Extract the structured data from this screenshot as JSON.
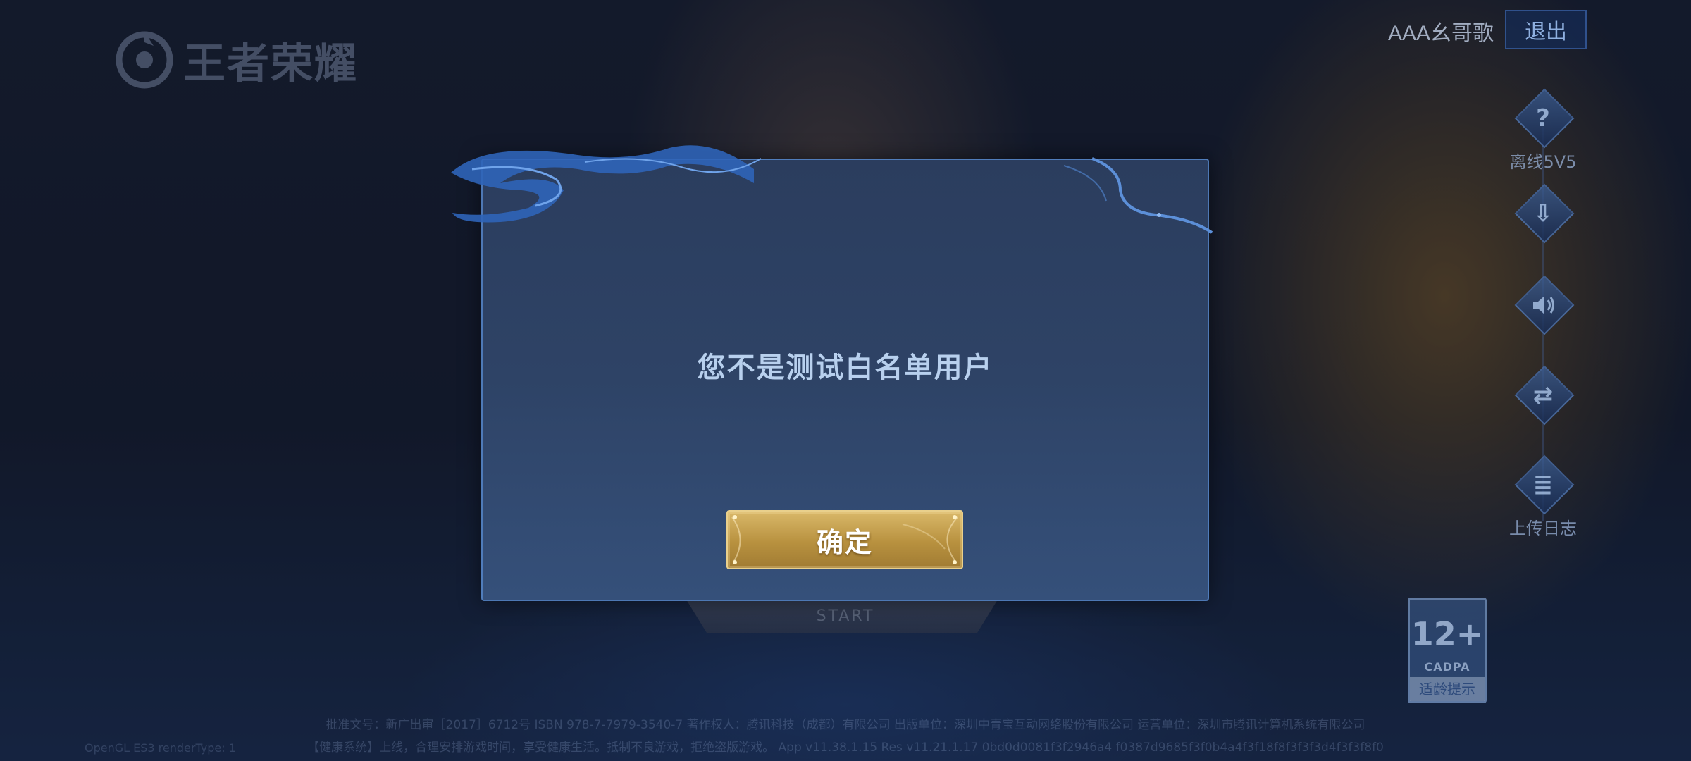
{
  "app": {
    "logo_text": "王者荣耀"
  },
  "header": {
    "user_name": "AAA幺哥歌",
    "exit_label": "退出"
  },
  "side_menu": {
    "items": [
      {
        "icon": "help-icon",
        "glyph": "?",
        "label": "离线5V5"
      },
      {
        "icon": "download-icon",
        "glyph": "⇩",
        "label": ""
      },
      {
        "icon": "speaker-icon",
        "glyph": "🔊",
        "label": ""
      },
      {
        "icon": "switch-account-icon",
        "glyph": "⇄",
        "label": ""
      },
      {
        "icon": "clipboard-icon",
        "glyph": "≣",
        "label": "上传日志"
      }
    ]
  },
  "age_badge": {
    "number": "12+",
    "org": "CADPA",
    "tip": "适龄提示"
  },
  "start": {
    "sub_label": "START"
  },
  "dialog": {
    "message": "您不是测试白名单用户",
    "confirm_label": "确定"
  },
  "footer": {
    "line1": "批准文号：新广出审［2017］6712号 ISBN 978-7-7979-3540-7 著作权人：腾讯科技（成都）有限公司 出版单位：深圳中青宝互动网络股份有限公司 运营单位：深圳市腾讯计算机系统有限公司",
    "line2": "【健康系统】上线，合理安排游戏时间，享受健康生活。抵制不良游戏，拒绝盗版游戏。 App v11.38.1.15 Res v11.21.1.17 0bd0d0081f3f2946a4 f0387d9685f3f0b4a4f3f18f8f3f3f3d4f3f3f8f0",
    "left_note": "OpenGL ES3 renderType: 1"
  },
  "colors": {
    "modal_bg": "#2e4366",
    "modal_border": "#5a8cd2",
    "confirm_gold": "#b8913f",
    "message_text": "#b8d0ee"
  }
}
